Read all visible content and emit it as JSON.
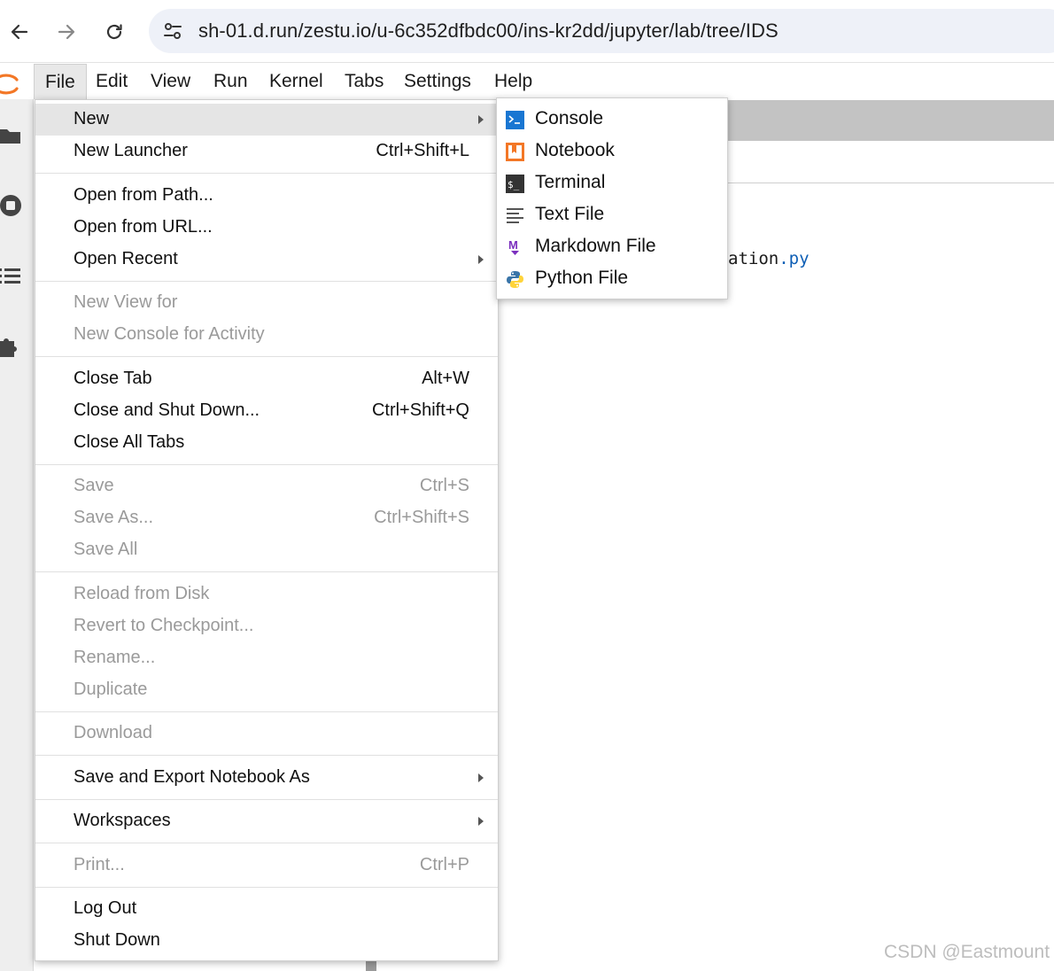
{
  "browser": {
    "url": "sh-01.d.run/zestu.io/u-6c352dfbdc00/ins-kr2dd/jupyter/lab/tree/IDS"
  },
  "menubar": {
    "items": [
      "File",
      "Edit",
      "View",
      "Run",
      "Kernel",
      "Tabs",
      "Settings",
      "Help"
    ],
    "active": "File"
  },
  "file_menu": {
    "items": [
      {
        "label": "New",
        "shortcut": "",
        "submenu": true,
        "disabled": false,
        "highlighted": true
      },
      {
        "label": "New Launcher",
        "shortcut": "Ctrl+Shift+L",
        "submenu": false,
        "disabled": false
      },
      {
        "label": "Open from Path...",
        "shortcut": "",
        "submenu": false,
        "disabled": false
      },
      {
        "label": "Open from URL...",
        "shortcut": "",
        "submenu": false,
        "disabled": false
      },
      {
        "label": "Open Recent",
        "shortcut": "",
        "submenu": true,
        "disabled": false
      },
      {
        "label": "New View for",
        "shortcut": "",
        "submenu": false,
        "disabled": true
      },
      {
        "label": "New Console for Activity",
        "shortcut": "",
        "submenu": false,
        "disabled": true
      },
      {
        "label": "Close Tab",
        "shortcut": "Alt+W",
        "submenu": false,
        "disabled": false
      },
      {
        "label": "Close and Shut Down...",
        "shortcut": "Ctrl+Shift+Q",
        "submenu": false,
        "disabled": false
      },
      {
        "label": "Close All Tabs",
        "shortcut": "",
        "submenu": false,
        "disabled": false
      },
      {
        "label": "Save",
        "shortcut": "Ctrl+S",
        "submenu": false,
        "disabled": true
      },
      {
        "label": "Save As...",
        "shortcut": "Ctrl+Shift+S",
        "submenu": false,
        "disabled": true
      },
      {
        "label": "Save All",
        "shortcut": "",
        "submenu": false,
        "disabled": true
      },
      {
        "label": "Reload from Disk",
        "shortcut": "",
        "submenu": false,
        "disabled": true
      },
      {
        "label": "Revert to Checkpoint...",
        "shortcut": "",
        "submenu": false,
        "disabled": true
      },
      {
        "label": "Rename...",
        "shortcut": "",
        "submenu": false,
        "disabled": true
      },
      {
        "label": "Duplicate",
        "shortcut": "",
        "submenu": false,
        "disabled": true
      },
      {
        "label": "Download",
        "shortcut": "",
        "submenu": false,
        "disabled": true
      },
      {
        "label": "Save and Export Notebook As",
        "shortcut": "",
        "submenu": true,
        "disabled": false
      },
      {
        "label": "Workspaces",
        "shortcut": "",
        "submenu": true,
        "disabled": false
      },
      {
        "label": "Print...",
        "shortcut": "Ctrl+P",
        "submenu": false,
        "disabled": true
      },
      {
        "label": "Log Out",
        "shortcut": "",
        "submenu": false,
        "disabled": false
      },
      {
        "label": "Shut Down",
        "shortcut": "",
        "submenu": false,
        "disabled": false
      }
    ]
  },
  "new_submenu": {
    "items": [
      {
        "label": "Console",
        "icon": "console-icon"
      },
      {
        "label": "Notebook",
        "icon": "notebook-icon"
      },
      {
        "label": "Terminal",
        "icon": "terminal-icon"
      },
      {
        "label": "Text File",
        "icon": "text-file-icon"
      },
      {
        "label": "Markdown File",
        "icon": "markdown-icon"
      },
      {
        "label": "Python File",
        "icon": "python-icon"
      }
    ]
  },
  "main": {
    "filename_partial": "ation",
    "filename_ext": ".py"
  },
  "watermark": "CSDN @Eastmount",
  "colors": {
    "jupyter_orange": "#f37726",
    "console_blue": "#1976d2",
    "markdown_purple": "#7b2fbe",
    "python_blue": "#3a75a8",
    "python_yellow": "#ffd43b",
    "disabled_text": "#9a9a9a"
  }
}
